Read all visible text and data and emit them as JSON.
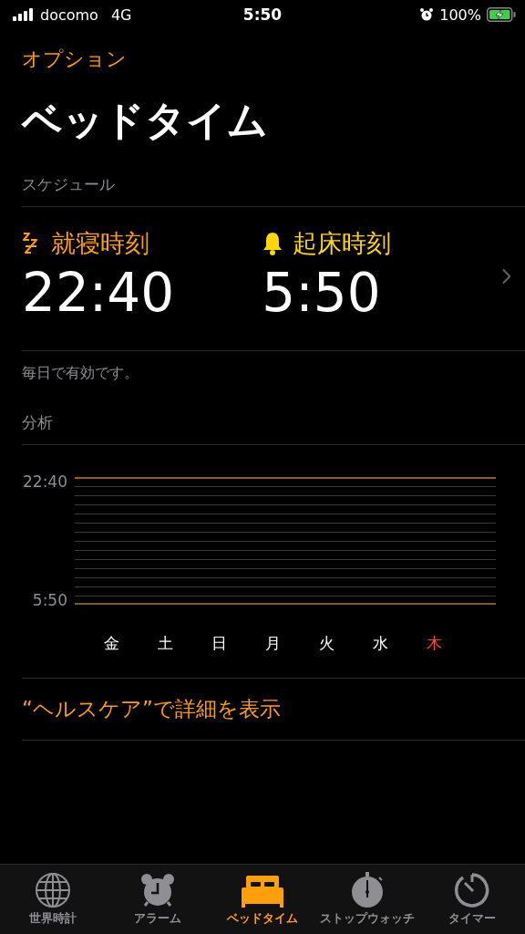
{
  "status_bar": {
    "carrier": "docomo",
    "network": "4G",
    "time": "5:50",
    "battery": "100%",
    "charging": true
  },
  "nav": {
    "back": "オプション"
  },
  "title": "ベッドタイム",
  "schedule": {
    "header": "スケジュール",
    "items": [
      {
        "kind": "bedtime",
        "label": "就寝時刻",
        "time": "22:40"
      },
      {
        "kind": "wake",
        "label": "起床時刻",
        "time": "5:50"
      }
    ],
    "note": "毎日で有効です。"
  },
  "analysis": {
    "header": "分析",
    "top_label": "22:40",
    "bottom_label": "5:50",
    "days": [
      {
        "label": "金",
        "today": false
      },
      {
        "label": "土",
        "today": false
      },
      {
        "label": "日",
        "today": false
      },
      {
        "label": "月",
        "today": false
      },
      {
        "label": "火",
        "today": false
      },
      {
        "label": "水",
        "today": false
      },
      {
        "label": "木",
        "today": true
      }
    ]
  },
  "health_link": "“ヘルスケア”で詳細を表示",
  "tabs": [
    {
      "kind": "globe",
      "label": "世界時計",
      "selected": false
    },
    {
      "kind": "alarm",
      "label": "アラーム",
      "selected": false
    },
    {
      "kind": "bed",
      "label": "ベッドタイム",
      "selected": true
    },
    {
      "kind": "stopwatch",
      "label": "ストップウォッチ",
      "selected": false
    },
    {
      "kind": "timer",
      "label": "タイマー",
      "selected": false
    }
  ]
}
